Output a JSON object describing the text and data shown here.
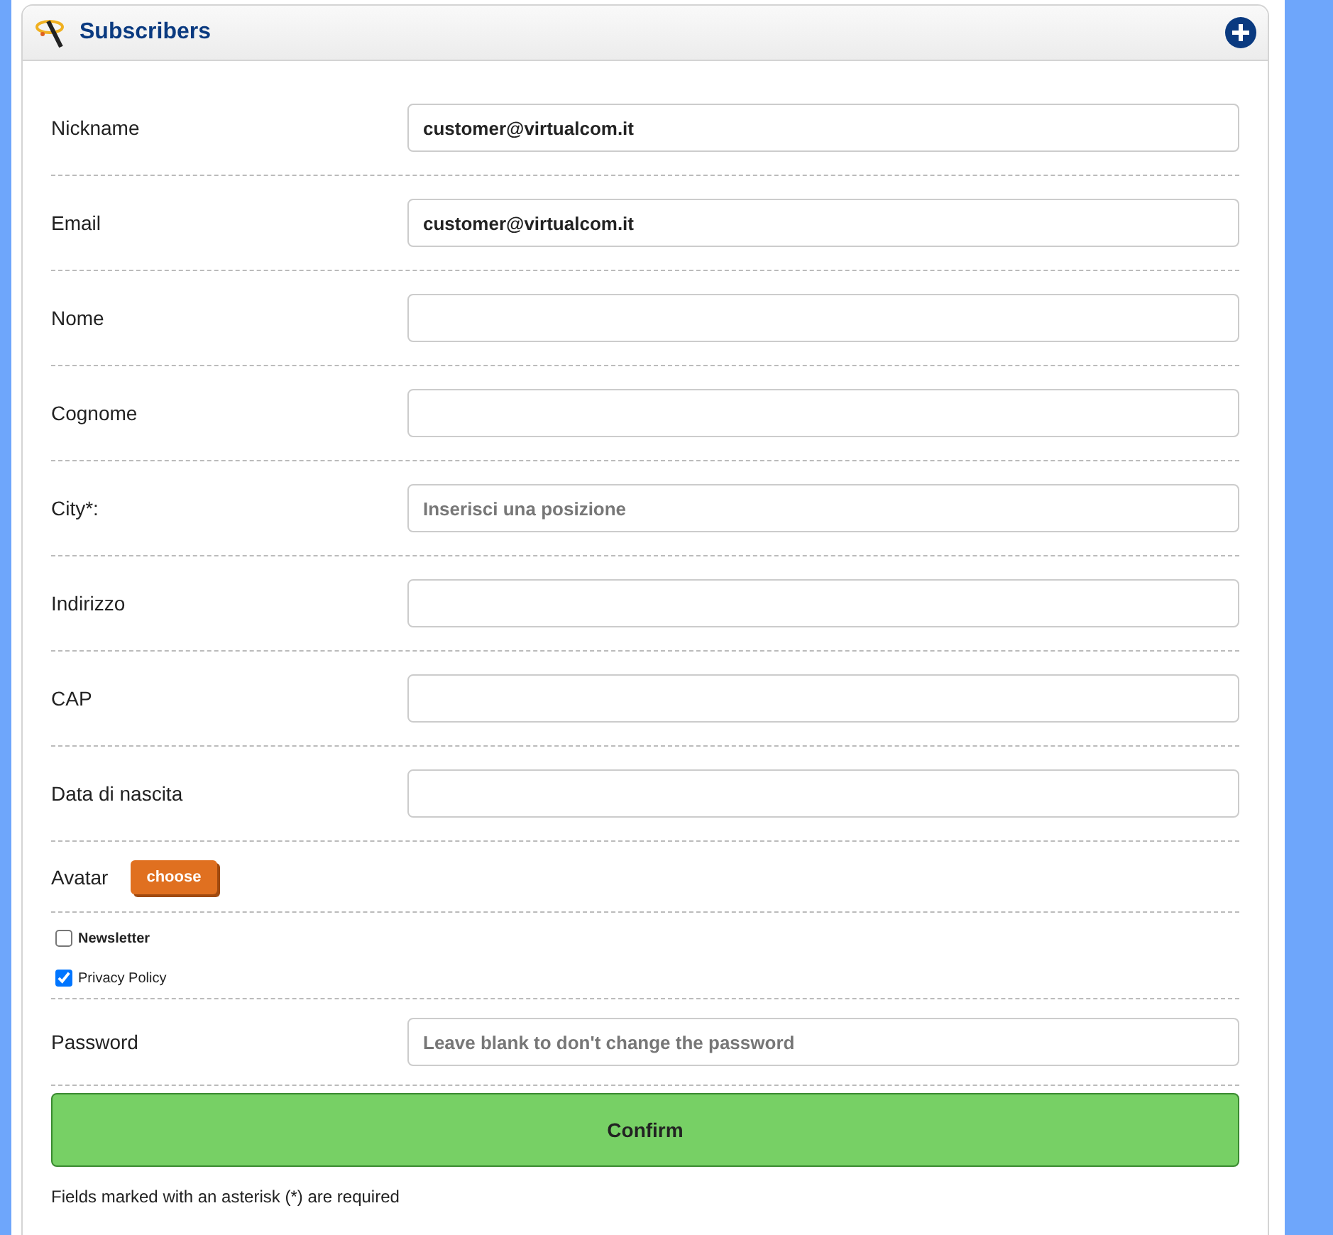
{
  "panel": {
    "title": "Subscribers"
  },
  "fields": [
    {
      "label": "Nickname",
      "value": "customer@virtualcom.it"
    },
    {
      "label": "Email",
      "value": "customer@virtualcom.it"
    },
    {
      "label": "Nome"
    },
    {
      "label": "Cognome"
    },
    {
      "label": "City*:",
      "placeholder": "Inserisci una posizione"
    },
    {
      "label": "Indirizzo"
    },
    {
      "label": "CAP"
    },
    {
      "label": "Data di nascita"
    }
  ],
  "avatar": {
    "label": "Avatar",
    "button": "choose"
  },
  "checkboxes": [
    {
      "label": "Newsletter",
      "checked": false,
      "bold": true
    },
    {
      "label": "Privacy Policy",
      "checked": true,
      "bold": false
    }
  ],
  "password": {
    "label": "Password",
    "placeholder": "Leave blank to don't change the password"
  },
  "confirm_button": "Confirm",
  "footnote": "Fields marked with an asterisk (*) are required"
}
